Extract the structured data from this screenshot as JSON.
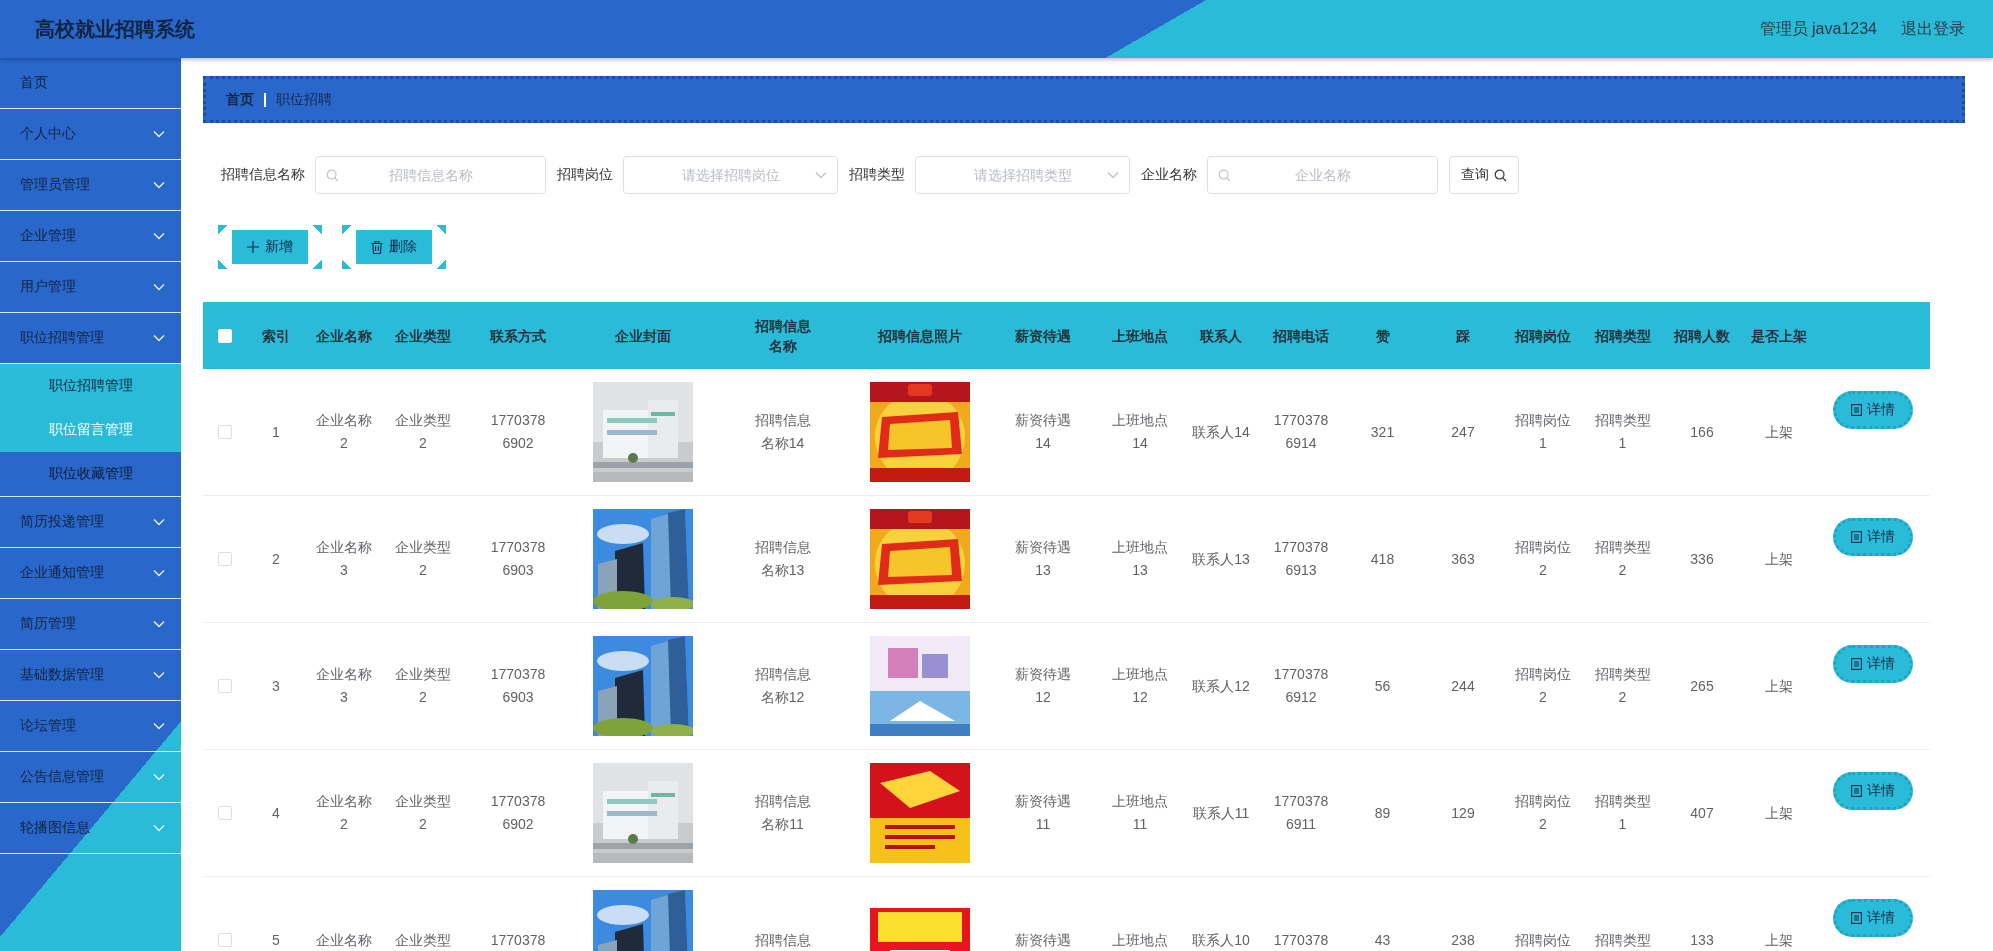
{
  "header": {
    "title": "高校就业招聘系统",
    "user": "管理员 java1234",
    "logout": "退出登录"
  },
  "sidebar": {
    "items": [
      {
        "label": "首页",
        "kind": "link"
      },
      {
        "label": "个人中心",
        "kind": "menu"
      },
      {
        "label": "管理员管理",
        "kind": "menu"
      },
      {
        "label": "企业管理",
        "kind": "menu"
      },
      {
        "label": "用户管理",
        "kind": "menu"
      },
      {
        "label": "职位招聘管理",
        "kind": "menu",
        "children": [
          {
            "label": "职位招聘管理",
            "highlighted": true,
            "selected": false
          },
          {
            "label": "职位留言管理",
            "highlighted": true,
            "selected": true
          },
          {
            "label": "职位收藏管理",
            "highlighted": false,
            "selected": false
          }
        ]
      },
      {
        "label": "简历投递管理",
        "kind": "menu"
      },
      {
        "label": "企业通知管理",
        "kind": "menu"
      },
      {
        "label": "简历管理",
        "kind": "menu"
      },
      {
        "label": "基础数据管理",
        "kind": "menu"
      },
      {
        "label": "论坛管理",
        "kind": "menu"
      },
      {
        "label": "公告信息管理",
        "kind": "menu"
      },
      {
        "label": "轮播图信息",
        "kind": "menu"
      }
    ]
  },
  "breadcrumb": [
    {
      "label": "首页",
      "current": false
    },
    {
      "label": "职位招聘",
      "current": true
    }
  ],
  "filters": [
    {
      "kind": "input",
      "label": "招聘信息名称",
      "placeholder": "招聘信息名称"
    },
    {
      "kind": "select",
      "label": "招聘岗位",
      "placeholder": "请选择招聘岗位"
    },
    {
      "kind": "select",
      "label": "招聘类型",
      "placeholder": "请选择招聘类型"
    },
    {
      "kind": "input",
      "label": "企业名称",
      "placeholder": "企业名称"
    }
  ],
  "search_button": "查询",
  "actions": [
    {
      "kind": "add",
      "label": "新增"
    },
    {
      "kind": "delete",
      "label": "删除"
    }
  ],
  "table": {
    "header_checked": false,
    "columns": [
      {
        "label": "索引",
        "kind": "text"
      },
      {
        "label": "企业名称",
        "kind": "text"
      },
      {
        "label": "企业类型",
        "kind": "text"
      },
      {
        "label": "联系方式",
        "kind": "text"
      },
      {
        "label": "企业封面",
        "kind": "picture"
      },
      {
        "label": "招聘信息名称",
        "kind": "text"
      },
      {
        "label": "招聘信息照片",
        "kind": "picture"
      },
      {
        "label": "薪资待遇",
        "kind": "text"
      },
      {
        "label": "上班地点",
        "kind": "text"
      },
      {
        "label": "联系人",
        "kind": "text"
      },
      {
        "label": "招聘电话",
        "kind": "text"
      },
      {
        "label": "赞",
        "kind": "text"
      },
      {
        "label": "踩",
        "kind": "text"
      },
      {
        "label": "招聘岗位",
        "kind": "text"
      },
      {
        "label": "招聘类型",
        "kind": "text"
      },
      {
        "label": "招聘人数",
        "kind": "text"
      },
      {
        "label": "是否上架",
        "kind": "text"
      }
    ],
    "rows": [
      {
        "checked": false,
        "detail": "详情",
        "cells": [
          "1",
          "企业名称\n2",
          "企业类型\n2",
          "1770378\n6902",
          {
            "kind": "picture"
          },
          "招聘信息名称14",
          {
            "kind": "picture"
          },
          "薪资待遇\n14",
          "上班地点\n14",
          "联系人14",
          "1770378\n6914",
          "321",
          "247",
          "招聘岗位\n1",
          "招聘类型\n1",
          "166",
          "上架"
        ]
      },
      {
        "checked": false,
        "detail": "详情",
        "cells": [
          "2",
          "企业名称\n3",
          "企业类型\n2",
          "1770378\n6903",
          {
            "kind": "picture"
          },
          "招聘信息名称13",
          {
            "kind": "picture"
          },
          "薪资待遇\n13",
          "上班地点\n13",
          "联系人13",
          "1770378\n6913",
          "418",
          "363",
          "招聘岗位\n2",
          "招聘类型\n2",
          "336",
          "上架"
        ]
      },
      {
        "checked": false,
        "detail": "详情",
        "cells": [
          "3",
          "企业名称\n3",
          "企业类型\n2",
          "1770378\n6903",
          {
            "kind": "picture"
          },
          "招聘信息名称12",
          {
            "kind": "picture"
          },
          "薪资待遇\n12",
          "上班地点\n12",
          "联系人12",
          "1770378\n6912",
          "56",
          "244",
          "招聘岗位\n2",
          "招聘类型\n2",
          "265",
          "上架"
        ]
      },
      {
        "checked": false,
        "detail": "详情",
        "cells": [
          "4",
          "企业名称\n2",
          "企业类型\n2",
          "1770378\n6902",
          {
            "kind": "picture"
          },
          "招聘信息名称11",
          {
            "kind": "picture"
          },
          "薪资待遇\n11",
          "上班地点\n11",
          "联系人11",
          "1770378\n6911",
          "89",
          "129",
          "招聘岗位\n2",
          "招聘类型\n1",
          "407",
          "上架"
        ]
      },
      {
        "checked": false,
        "detail": "详情",
        "cells": [
          "5",
          "企业名称",
          "企业类型",
          "1770378",
          {
            "kind": "picture"
          },
          "招聘信息",
          {
            "kind": "picture"
          },
          "薪资待遇",
          "上班地点",
          "联系人10",
          "1770378",
          "43",
          "238",
          "招聘岗位",
          "招聘类型",
          "133",
          "上架"
        ]
      }
    ]
  }
}
